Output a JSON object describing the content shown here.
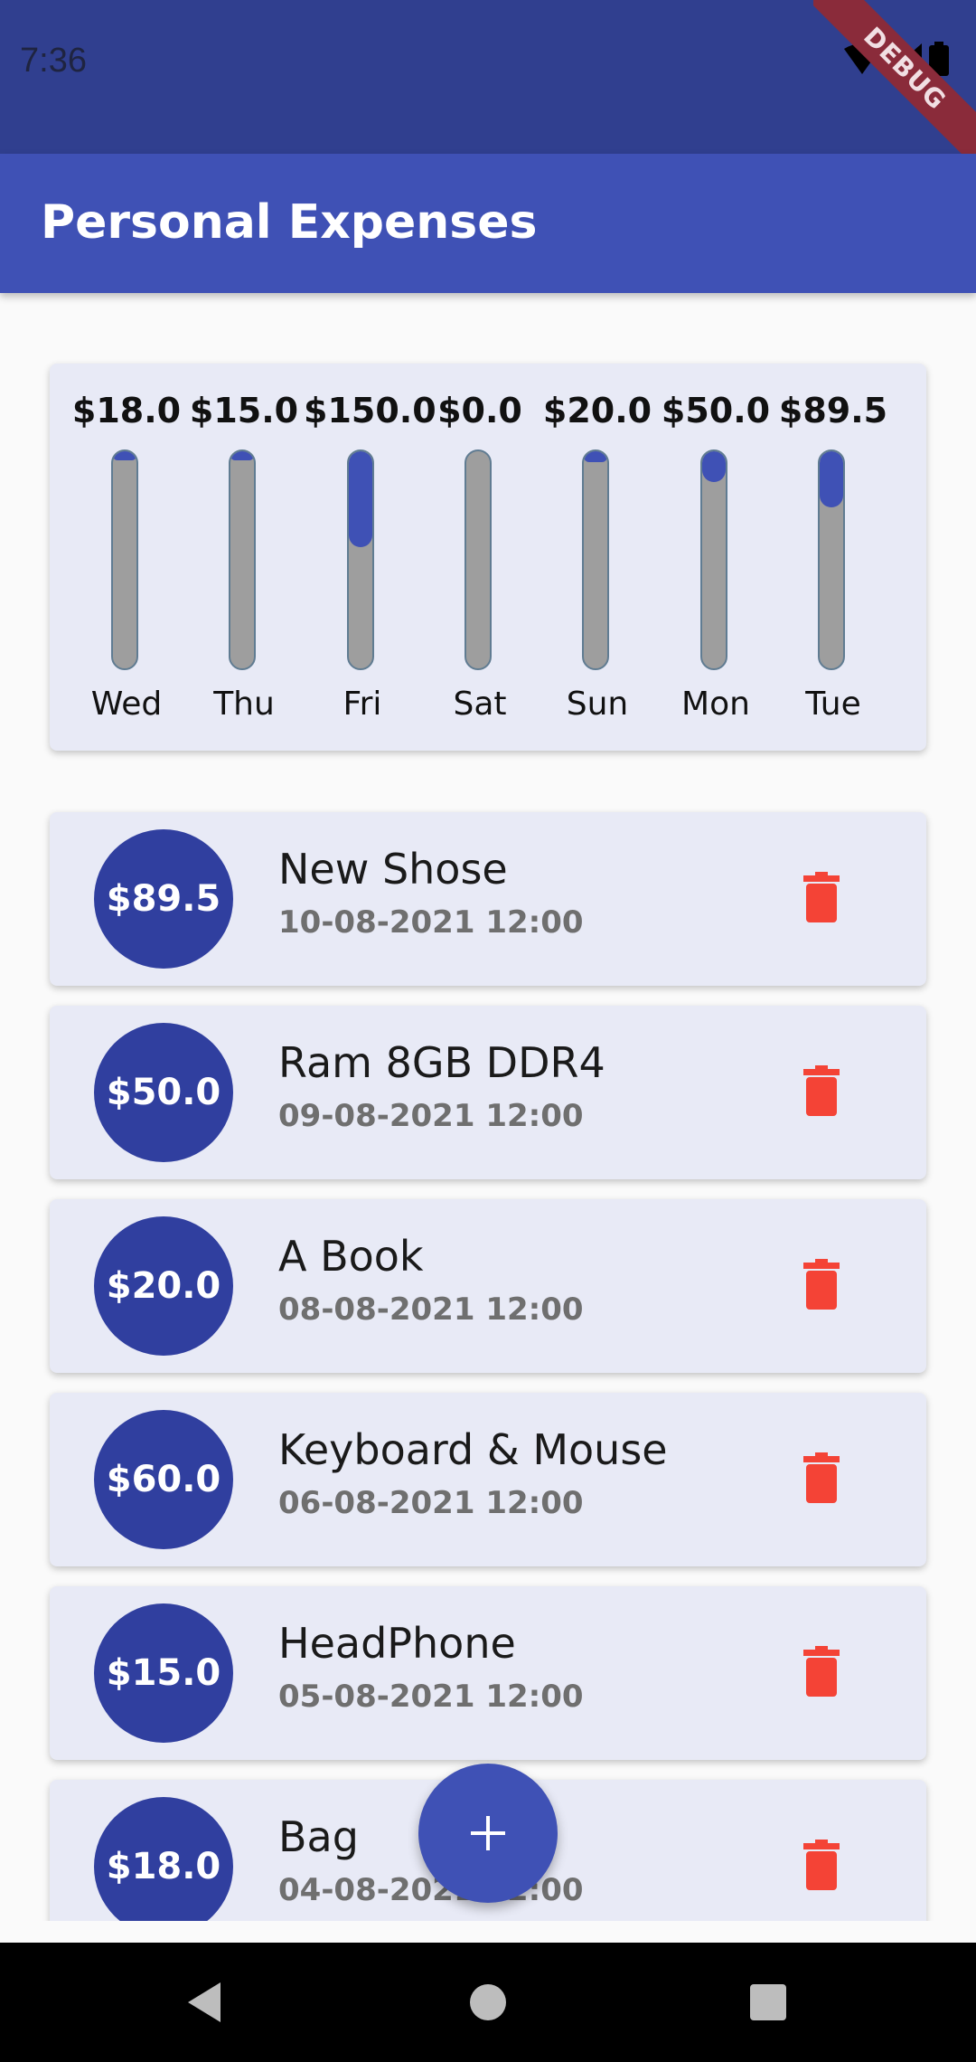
{
  "status_bar": {
    "time": "7:36",
    "icons": [
      "wifi-icon",
      "cell-signal-icon",
      "battery-icon"
    ],
    "debug_banner": "DEBUG"
  },
  "app_bar": {
    "title": "Personal Expenses"
  },
  "chart": {
    "days": [
      {
        "label": "Wed",
        "amount": "$18.0",
        "fill_fraction": 0.04
      },
      {
        "label": "Thu",
        "amount": "$15.0",
        "fill_fraction": 0.04
      },
      {
        "label": "Fri",
        "amount": "$150.0",
        "fill_fraction": 0.44
      },
      {
        "label": "Sat",
        "amount": "$0.0",
        "fill_fraction": 0.0
      },
      {
        "label": "Sun",
        "amount": "$20.0",
        "fill_fraction": 0.05
      },
      {
        "label": "Mon",
        "amount": "$50.0",
        "fill_fraction": 0.14
      },
      {
        "label": "Tue",
        "amount": "$89.5",
        "fill_fraction": 0.26
      }
    ]
  },
  "transactions": [
    {
      "amount": "$89.5",
      "title": "New Shose",
      "date": "10-08-2021 12:00"
    },
    {
      "amount": "$50.0",
      "title": "Ram 8GB DDR4",
      "date": "09-08-2021 12:00"
    },
    {
      "amount": "$20.0",
      "title": "A Book",
      "date": "08-08-2021 12:00"
    },
    {
      "amount": "$60.0",
      "title": "Keyboard & Mouse",
      "date": "06-08-2021 12:00"
    },
    {
      "amount": "$15.0",
      "title": "HeadPhone",
      "date": "05-08-2021 12:00"
    },
    {
      "amount": "$18.0",
      "title": "Bag",
      "date": "04-08-2021 12:00"
    }
  ],
  "fab": {
    "icon": "plus-icon"
  },
  "nav_bar": {
    "icons": [
      "back-icon",
      "home-icon",
      "recents-icon"
    ]
  },
  "colors": {
    "primary": "#3f51b5",
    "primary_dark": "#303f9f",
    "delete": "#f44336",
    "card_bg": "#e8eaf6"
  }
}
